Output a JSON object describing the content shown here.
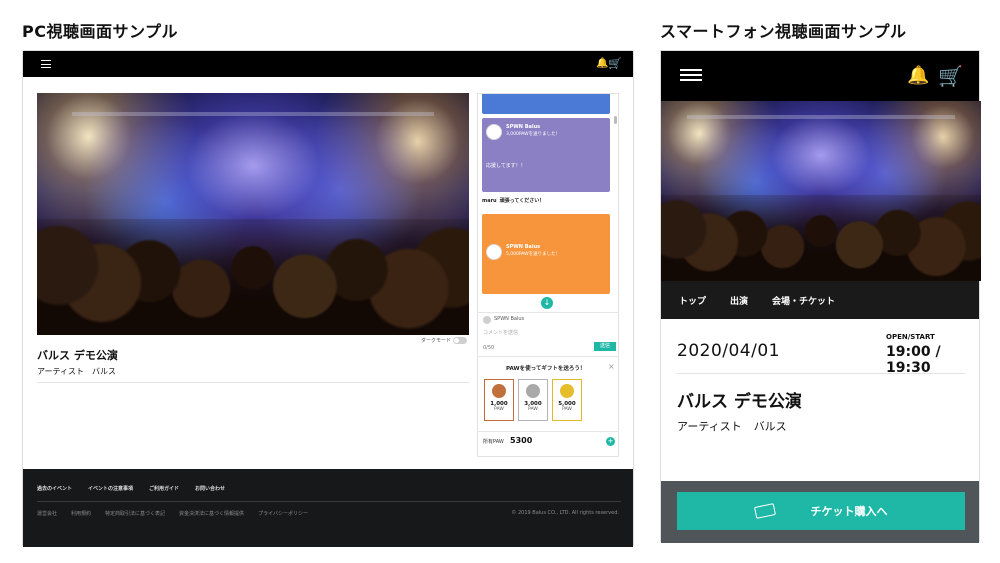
{
  "titles": {
    "pc": "PC視聴画面サンプル",
    "sp": "スマートフォン視聴画面サンプル"
  },
  "icons": {
    "menu": "hamburger-icon",
    "bell": "bell-icon",
    "cart": "cart-icon",
    "ticket": "ticket-icon"
  },
  "glyphs": {
    "bell": "🔔",
    "cart": "🛒",
    "down": "↓",
    "close": "×",
    "plus": "+"
  },
  "colors": {
    "accent": "#1fb8a6",
    "footer": "#17181a",
    "msg_blue": "#4a7ad6",
    "msg_purple": "#8b80c4",
    "msg_orange": "#f6953b"
  },
  "pc": {
    "dark_mode_label": "ダークモード",
    "event_title": "バルス デモ公演",
    "artist_label": "アーティスト",
    "artist_name": "バルス",
    "chat": {
      "msg1": {
        "name": "SPWN Balus",
        "sent": "3,000PAWを送りました！",
        "text": "応援してます！！"
      },
      "maru": {
        "user": "maru",
        "text": "頑張ってください！"
      },
      "msg2": {
        "name": "SPWN Balus",
        "sent": "5,000PAWを送りました！"
      },
      "input_user": "SPWN Balus",
      "input_placeholder": "コメントを送信",
      "count": "0/50",
      "send": "送信",
      "gift_title": "PAWを使ってギフトを送ろう！",
      "coins": [
        {
          "value": "1,000",
          "unit": "PAW"
        },
        {
          "value": "3,000",
          "unit": "PAW"
        },
        {
          "value": "5,000",
          "unit": "PAW"
        }
      ],
      "owned_label": "所有PAW",
      "owned_value": "5300"
    },
    "footer": {
      "links": [
        "過去のイベント",
        "イベントの注意事項",
        "ご利用ガイド",
        "お問い合わせ"
      ],
      "sub": [
        "運営会社",
        "利用規約",
        "特定商取引法に基づく表記",
        "資金決済法に基づく情報提供",
        "プライバシーポリシー"
      ],
      "copyright": "© 2019 Balus CO., LTD. All rights reserved."
    }
  },
  "sp": {
    "nav": [
      "トップ",
      "出演",
      "会場・チケット"
    ],
    "date": "2020/04/01",
    "open_label": "OPEN/START",
    "open_time": "19:00 / 19:30",
    "event_title": "バルス デモ公演",
    "artist_label": "アーティスト",
    "artist_name": "バルス",
    "ticket_button": "チケット購入へ"
  }
}
